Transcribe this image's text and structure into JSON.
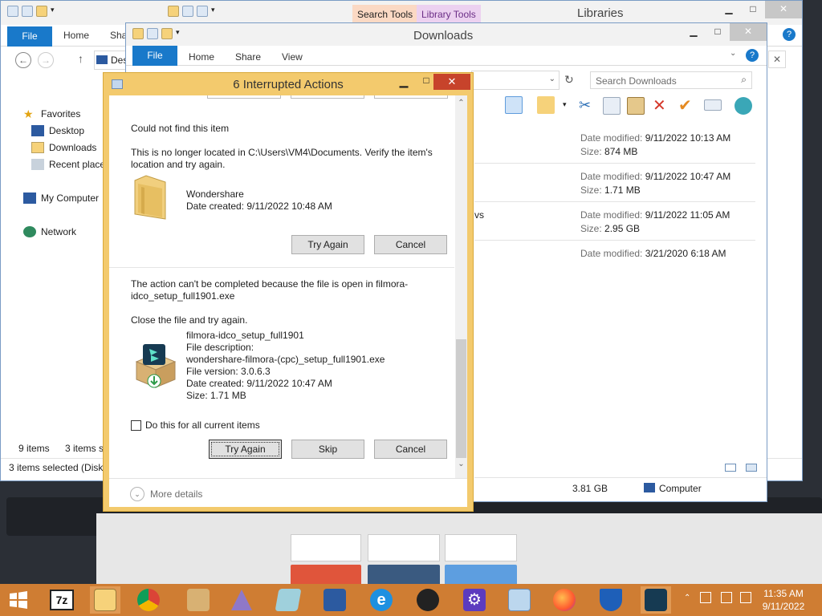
{
  "libraries_window": {
    "title": "Libraries",
    "context_tabs": [
      "Search Tools",
      "Library Tools"
    ],
    "tabs": [
      "File",
      "Home",
      "Sha"
    ],
    "address_fragment": "Des",
    "nav": {
      "favorites": "Favorites",
      "desktop": "Desktop",
      "downloads": "Downloads",
      "recent": "Recent places",
      "my_computer": "My Computer",
      "network": "Network"
    },
    "status_items": "9 items",
    "status_selected": "3 items s",
    "status_bottom": "3 items selected (Disk f"
  },
  "downloads_window": {
    "title": "Downloads",
    "tabs": [
      "File",
      "Home",
      "Share",
      "View"
    ],
    "search_placeholder": "Search Downloads",
    "files": [
      {
        "date_label": "Date modified:",
        "date": "9/11/2022 10:13 AM",
        "size_label": "Size:",
        "size": "874 MB",
        "name_fragment": ""
      },
      {
        "date_label": "Date modified:",
        "date": "9/11/2022 10:47 AM",
        "size_label": "Size:",
        "size": "1.71 MB",
        "name_fragment": ""
      },
      {
        "date_label": "Date modified:",
        "date": "9/11/2022 11:05 AM",
        "size_label": "Size:",
        "size": "2.95 GB",
        "name_fragment": "vs"
      },
      {
        "date_label": "Date modified:",
        "date": "3/21/2020 6:18 AM",
        "size_label": "",
        "size": "",
        "name_fragment": ""
      }
    ],
    "status_size": "3.81 GB",
    "status_computer": "Computer"
  },
  "dialog": {
    "title": "6 Interrupted Actions",
    "item1": {
      "heading": "Could not find this item",
      "message": "This is no longer located in C:\\Users\\VM4\\Documents. Verify the item's location and try again.",
      "name": "Wondershare",
      "date_created": "Date created: 9/11/2022 10:48 AM",
      "try_again": "Try Again",
      "cancel": "Cancel"
    },
    "item2": {
      "message": "The action can't be completed because the file is open in filmora-idco_setup_full1901.exe",
      "instruction": "Close the file and try again.",
      "name": "filmora-idco_setup_full1901",
      "description_label": "File description:",
      "description": "wondershare-filmora-(cpc)_setup_full1901.exe",
      "version": "File version: 3.0.6.3",
      "date_created": "Date created: 9/11/2022 10:47 AM",
      "size": "Size: 1.71 MB"
    },
    "checkbox_label": "Do this for all current items",
    "checkbox_checked": false,
    "try_again": "Try Again",
    "skip": "Skip",
    "cancel": "Cancel",
    "more_details": "More details"
  },
  "taskbar": {
    "apps": [
      "windows-start-icon",
      "7zip-icon",
      "file-explorer-icon",
      "chrome-icon",
      "installer-icon",
      "affinity-icon",
      "notepad-icon",
      "computer-icon",
      "ie-icon",
      "davinci-icon",
      "settings-icon",
      "control-panel-icon",
      "firefox-icon",
      "defender-icon",
      "filmora-icon"
    ],
    "seven_zip_label": "7z",
    "time": "11:35 AM",
    "date": "9/11/2022"
  },
  "colors": {
    "dialog_border": "#f3ca6d",
    "close_red": "#c7432b",
    "file_tab_blue": "#1979ca",
    "taskbar": "#cf7d33"
  }
}
